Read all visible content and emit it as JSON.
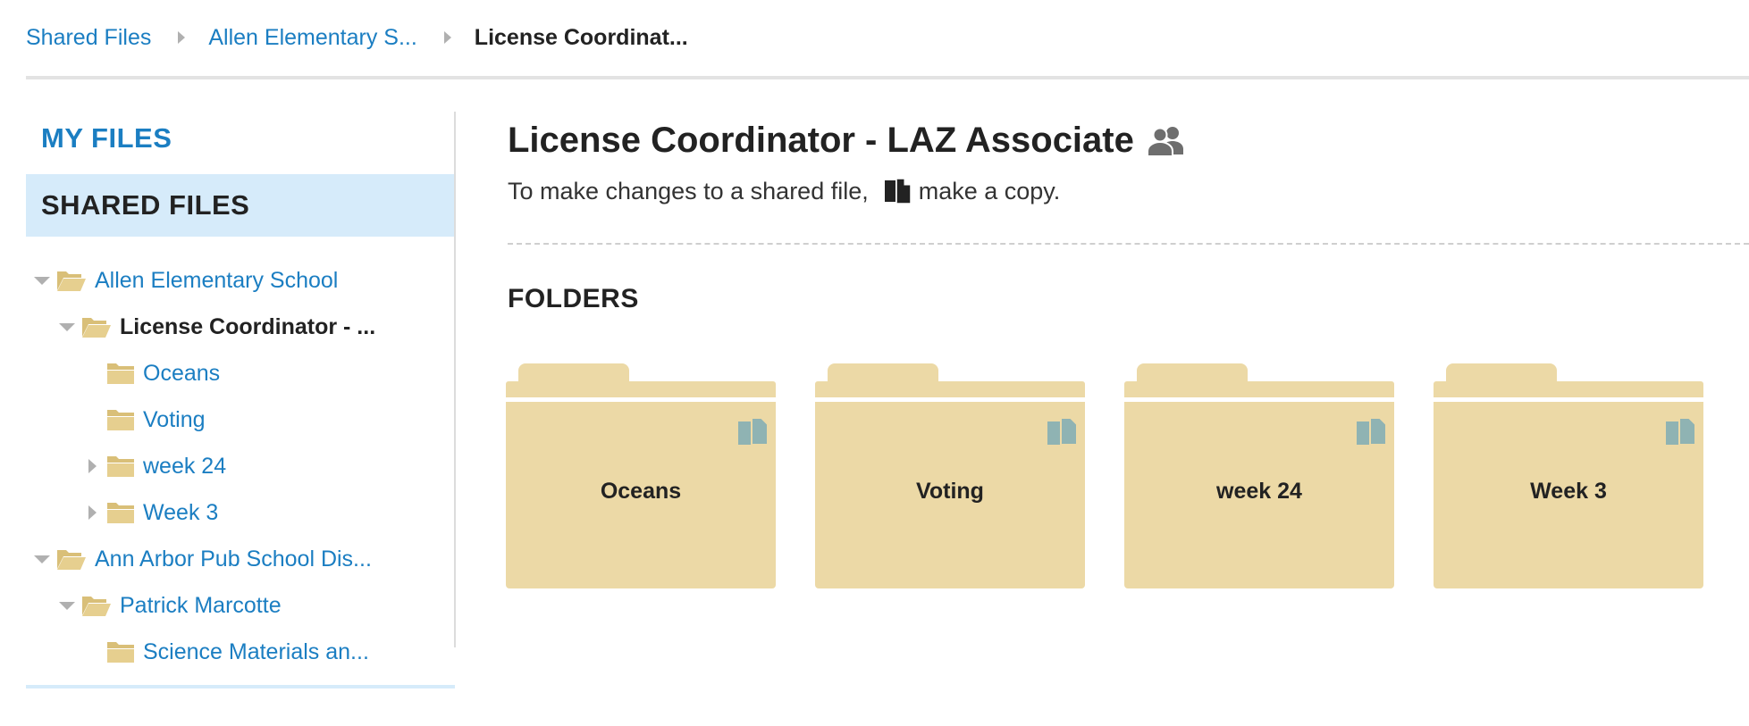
{
  "breadcrumb": {
    "items": [
      "Shared Files",
      "Allen Elementary S..."
    ],
    "current": "License Coordinat..."
  },
  "sidebar": {
    "my_files": "MY FILES",
    "shared_files": "SHARED FILES",
    "tree": [
      {
        "label": "Allen Elementary School",
        "state": "expanded"
      },
      {
        "label": "License Coordinator - ...",
        "state": "expanded",
        "current": true
      },
      {
        "label": "Oceans",
        "state": "leaf"
      },
      {
        "label": "Voting",
        "state": "leaf"
      },
      {
        "label": "week 24",
        "state": "collapsed"
      },
      {
        "label": "Week 3",
        "state": "collapsed"
      },
      {
        "label": "Ann Arbor Pub School Dis...",
        "state": "expanded"
      },
      {
        "label": "Patrick Marcotte",
        "state": "expanded"
      },
      {
        "label": "Science Materials an...",
        "state": "leaf"
      }
    ]
  },
  "main": {
    "title": "License Coordinator - LAZ Associate",
    "subtitle_before": "To make changes to a shared file,",
    "subtitle_after": "make a copy.",
    "folders_heading": "FOLDERS",
    "folders": [
      "Oceans",
      "Voting",
      "week 24",
      "Week 3"
    ]
  },
  "icons": {
    "group": "shared-group-icon",
    "copy": "copy-icon",
    "folder_open": "folder-open-icon",
    "folder_closed": "folder-icon"
  },
  "colors": {
    "link": "#1b7ec2",
    "selected_bg": "#d6ebfa",
    "folder": "#ecd9a6",
    "folder_icon": "#d9bf78",
    "copy_icon_light": "#8fb3b3"
  }
}
